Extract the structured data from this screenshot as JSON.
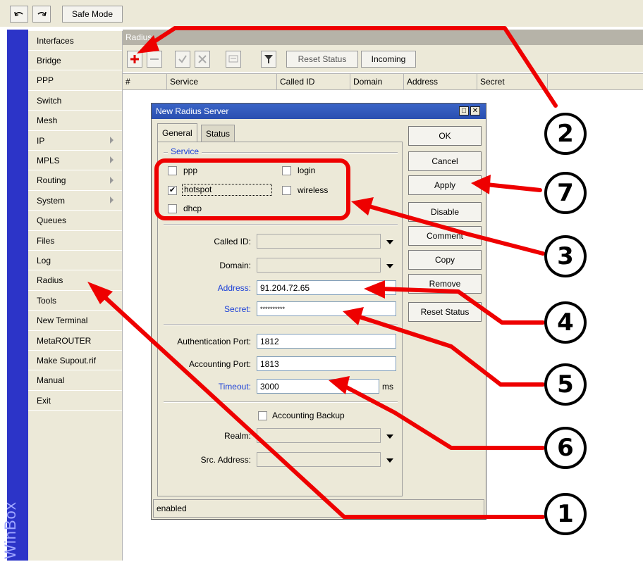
{
  "toolbar": {
    "undo_icon": "undo-icon",
    "redo_icon": "redo-icon",
    "safe_mode": "Safe Mode"
  },
  "sidebar": {
    "brand": "WinBox",
    "items": [
      {
        "label": "Interfaces",
        "submenu": false
      },
      {
        "label": "Bridge",
        "submenu": false
      },
      {
        "label": "PPP",
        "submenu": false
      },
      {
        "label": "Switch",
        "submenu": false
      },
      {
        "label": "Mesh",
        "submenu": false
      },
      {
        "label": "IP",
        "submenu": true
      },
      {
        "label": "MPLS",
        "submenu": true
      },
      {
        "label": "Routing",
        "submenu": true
      },
      {
        "label": "System",
        "submenu": true
      },
      {
        "label": "Queues",
        "submenu": false
      },
      {
        "label": "Files",
        "submenu": false
      },
      {
        "label": "Log",
        "submenu": false
      },
      {
        "label": "Radius",
        "submenu": false
      },
      {
        "label": "Tools",
        "submenu": false
      },
      {
        "label": "New Terminal",
        "submenu": false
      },
      {
        "label": "MetaROUTER",
        "submenu": false
      },
      {
        "label": "Make Supout.rif",
        "submenu": false
      },
      {
        "label": "Manual",
        "submenu": false
      },
      {
        "label": "Exit",
        "submenu": false
      }
    ]
  },
  "radius_window": {
    "title": "Radius",
    "buttons": {
      "reset_status": "Reset Status",
      "incoming": "Incoming"
    },
    "columns": [
      "#",
      "Service",
      "Called ID",
      "Domain",
      "Address",
      "Secret"
    ]
  },
  "dialog": {
    "title": "New Radius Server",
    "tabs": [
      "General",
      "Status"
    ],
    "service_legend": "Service",
    "services": {
      "ppp": {
        "label": "ppp",
        "checked": false
      },
      "login": {
        "label": "login",
        "checked": false
      },
      "hotspot": {
        "label": "hotspot",
        "checked": true
      },
      "wireless": {
        "label": "wireless",
        "checked": false
      },
      "dhcp": {
        "label": "dhcp",
        "checked": false
      }
    },
    "fields": {
      "called_id": {
        "label": "Called ID:",
        "value": ""
      },
      "domain": {
        "label": "Domain:",
        "value": ""
      },
      "address": {
        "label": "Address:",
        "value": "91.204.72.65"
      },
      "secret": {
        "label": "Secret:",
        "value": "**********"
      },
      "auth_port": {
        "label": "Authentication Port:",
        "value": "1812"
      },
      "acct_port": {
        "label": "Accounting Port:",
        "value": "1813"
      },
      "timeout": {
        "label": "Timeout:",
        "value": "3000",
        "unit": "ms"
      },
      "accounting_backup": {
        "label": "Accounting Backup",
        "checked": false
      },
      "realm": {
        "label": "Realm:",
        "value": ""
      },
      "src_address": {
        "label": "Src. Address:",
        "value": ""
      }
    },
    "side_buttons": {
      "ok": "OK",
      "cancel": "Cancel",
      "apply": "Apply",
      "disable": "Disable",
      "comment": "Comment",
      "copy": "Copy",
      "remove": "Remove",
      "reset_status": "Reset Status"
    },
    "status": "enabled"
  },
  "callouts": [
    "1",
    "2",
    "3",
    "4",
    "5",
    "6",
    "7"
  ],
  "colors": {
    "annotation": "#ee0000",
    "title_bar": "#2a4fb0",
    "winbox_strip": "#2c34c8",
    "field_label_blue": "#1a3fd8"
  }
}
